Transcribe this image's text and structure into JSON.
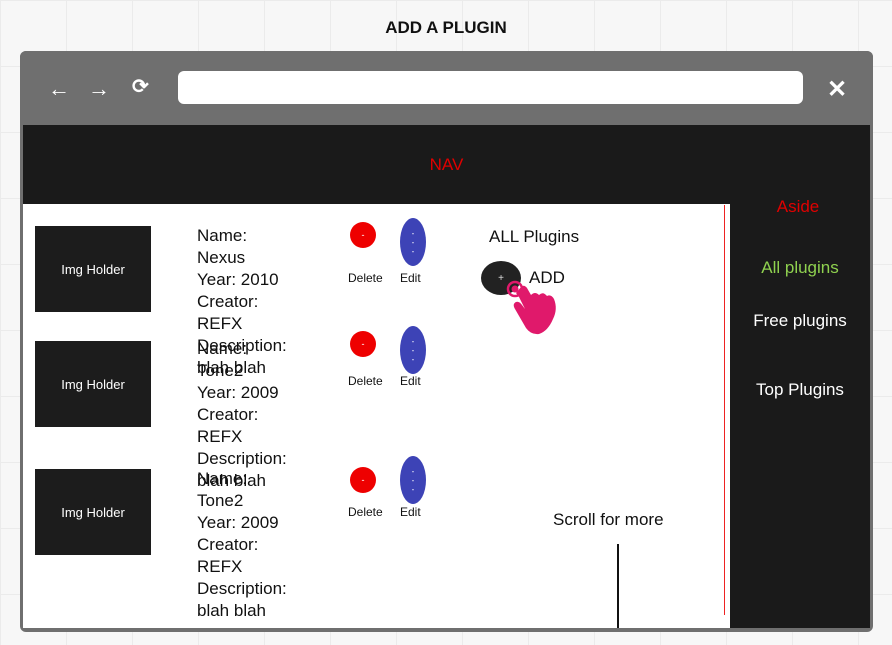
{
  "page_title": "ADD A PLUGIN",
  "toolbar": {
    "back_glyph": "←",
    "forward_glyph": "→",
    "reload_glyph": "⟳",
    "url_value": "",
    "close_glyph": "✕"
  },
  "nav": {
    "label": "NAV"
  },
  "aside": {
    "title": "Aside",
    "items": [
      {
        "label": "All plugins",
        "color": "#8fd14f"
      },
      {
        "label": "Free plugins",
        "color": "#ffffff"
      },
      {
        "label": "Top Plugins",
        "color": "#ffffff"
      }
    ]
  },
  "plugins": [
    {
      "img_label": "Img Holder",
      "name": "Name: Nexus",
      "year": "Year: 2010",
      "creator": "Creator: REFX",
      "description": "Description: blah blah",
      "delete_label": "Delete",
      "edit_label": "Edit",
      "delete_glyph": "-",
      "edit_glyph": "-"
    },
    {
      "img_label": "Img Holder",
      "name": "Name: Tone2",
      "year": "Year: 2009",
      "creator": "Creator: REFX",
      "description": "Description: blah blah",
      "delete_label": "Delete",
      "edit_label": "Edit",
      "delete_glyph": "-",
      "edit_glyph": "-"
    },
    {
      "img_label": "Img Holder",
      "name": "Name: Tone2",
      "year": "Year: 2009",
      "creator": "Creator: REFX",
      "description": "Description: blah blah",
      "delete_label": "Delete",
      "edit_label": "Edit",
      "delete_glyph": "-",
      "edit_glyph": "-"
    }
  ],
  "main_panel": {
    "heading": "ALL Plugins",
    "add_label": "ADD",
    "add_glyph": "+",
    "scroll_hint": "Scroll for more"
  },
  "colors": {
    "nav_text": "#e00000",
    "delete_button": "#ee0000",
    "edit_button": "#3d43b6",
    "pointer": "#e0196b",
    "frame": "#6f6f6f",
    "dark_panel": "#1a1a1a"
  },
  "icons": {
    "pointer": "hand-pointer-icon"
  }
}
